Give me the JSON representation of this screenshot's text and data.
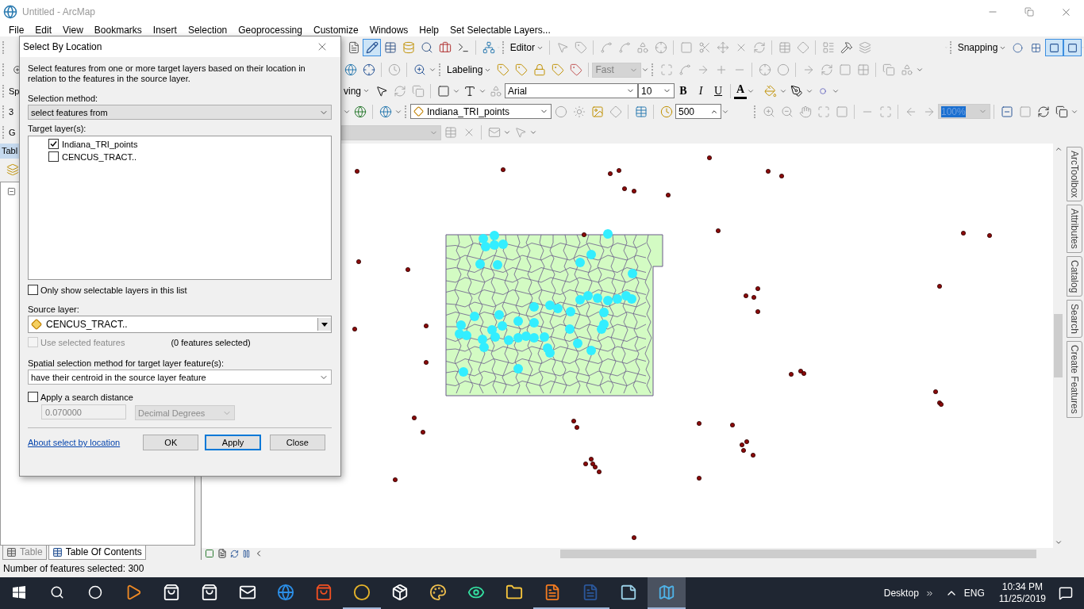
{
  "window": {
    "title": "Untitled - ArcMap"
  },
  "menu": [
    "File",
    "Edit",
    "View",
    "Bookmarks",
    "Insert",
    "Selection",
    "Geoprocessing",
    "Customize",
    "Windows",
    "Help",
    "Set Selectable Layers..."
  ],
  "toolbars": {
    "editor": "Editor",
    "snapping": "Snapping",
    "labeling": "Labeling",
    "label_engine": {
      "value": "Fast",
      "disabled": true
    },
    "drawing": "ving",
    "font": "Arial",
    "font_size": "10",
    "bold": "B",
    "italic": "I",
    "underline": "U",
    "font_color": "A",
    "layer": "Indiana_TRI_points",
    "scale": "500",
    "zoom": {
      "value": "100%",
      "disabled": true
    }
  },
  "left_stubs": [
    "Sp",
    "3",
    "G"
  ],
  "toc": {
    "title": "Tabl",
    "tabs": [
      {
        "label": "Table",
        "selected": false
      },
      {
        "label": "Table Of Contents",
        "selected": true
      }
    ]
  },
  "dock_tabs": [
    "ArcToolbox",
    "Attributes",
    "Catalog",
    "Search",
    "Create Features"
  ],
  "dialog": {
    "title": "Select By Location",
    "description": "Select features from one or more target layers based on their location in relation to the features in the source layer.",
    "selection_method": {
      "label": "Selection method:",
      "value": "select features from"
    },
    "target_layers": {
      "label": "Target layer(s):",
      "items": [
        {
          "name": "Indiana_TRI_points",
          "checked": true
        },
        {
          "name": "CENCUS_TRACT..",
          "checked": false
        }
      ]
    },
    "only_selectable": {
      "label": "Only show selectable layers in this list",
      "checked": false
    },
    "source_layer": {
      "label": "Source layer:",
      "value": "CENCUS_TRACT.."
    },
    "use_selected": {
      "label": "Use selected features",
      "checked": false,
      "disabled": true
    },
    "selected_count": "(0 features selected)",
    "spatial_method": {
      "label": "Spatial selection method for target layer feature(s):",
      "value": "have their centroid in the source layer feature"
    },
    "search_distance": {
      "label": "Apply a search distance",
      "checked": false
    },
    "distance": {
      "value": "0.070000",
      "disabled": true
    },
    "units": {
      "value": "Decimal Degrees",
      "disabled": true
    },
    "help_link": "About select by location",
    "buttons": [
      {
        "label": "OK",
        "selected": false
      },
      {
        "label": "Apply",
        "selected": true
      },
      {
        "label": "Close",
        "selected": false
      }
    ]
  },
  "status_bar": "Number of features selected: 300",
  "taskbar": {
    "apps": [
      {
        "kind": "video",
        "running": false,
        "selected": false
      },
      {
        "kind": "shop",
        "running": false,
        "selected": false
      },
      {
        "kind": "shop",
        "running": false,
        "selected": false
      },
      {
        "kind": "mail",
        "running": false,
        "selected": false
      },
      {
        "kind": "browser",
        "running": false,
        "selected": false
      },
      {
        "kind": "store",
        "running": false,
        "selected": false
      },
      {
        "kind": "chrome",
        "running": true,
        "selected": false
      },
      {
        "kind": "box",
        "running": false,
        "selected": false
      },
      {
        "kind": "paint",
        "running": false,
        "selected": false
      },
      {
        "kind": "owl",
        "running": false,
        "selected": false
      },
      {
        "kind": "folder",
        "running": false,
        "selected": false
      },
      {
        "kind": "pdf",
        "running": true,
        "selected": false
      },
      {
        "kind": "word",
        "running": true,
        "selected": false
      },
      {
        "kind": "notes",
        "running": false,
        "selected": false
      },
      {
        "kind": "arcmap",
        "running": true,
        "selected": true
      }
    ],
    "desktop": "Desktop",
    "language": "ENG",
    "time": "10:34 PM",
    "date": "11/25/2019"
  }
}
